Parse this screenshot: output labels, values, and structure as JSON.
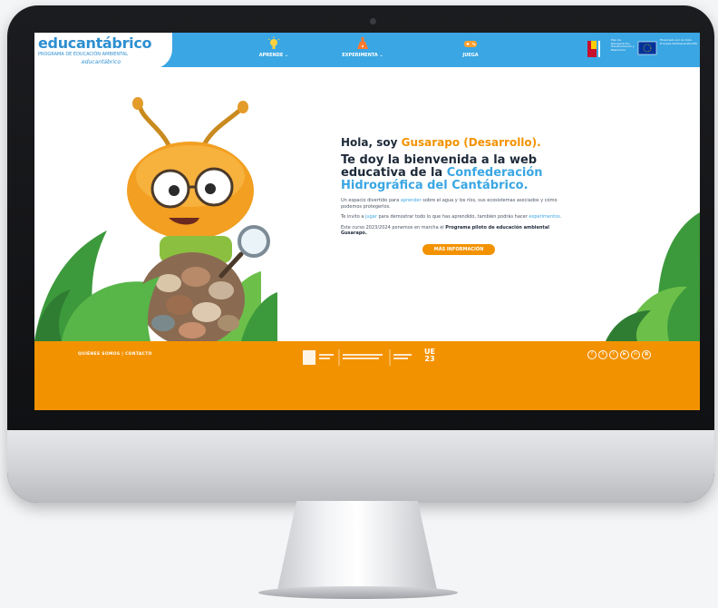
{
  "header": {
    "logo_title": "educantábrico",
    "logo_subtitle": "PROGRAMA DE EDUCACIÓN AMBIENTAL",
    "logo_subtitle2": "educantábrico",
    "nav": [
      {
        "label": "APRENDE ⌄",
        "icon": "lightbulb-icon"
      },
      {
        "label": "EXPERIMENTA ⌄",
        "icon": "flask-icon"
      },
      {
        "label": "JUEGA",
        "icon": "gamepad-icon"
      }
    ],
    "eu_text_1": "Plan de Recuperación, Transformación y Resiliencia",
    "eu_text_2": "Financiado por la Unión Europea NextGenerationEU"
  },
  "hero": {
    "greeting_prefix": "Hola, soy ",
    "greeting_name": "Gusarapo (Desarrollo).",
    "welcome_prefix": "Te doy la bienvenida a la web educativa de la ",
    "welcome_org": "Confederación Hidrográfica del Cantábrico.",
    "p1_a": "Un espacio divertido para ",
    "p1_link": "aprender",
    "p1_b": " sobre el agua y los ríos, sus ecosistemas asociados y cómo podemos protegerlos.",
    "p2_a": "Te invito a ",
    "p2_link1": "jugar",
    "p2_b": " para demostrar todo lo que has aprendido, también podrás hacer ",
    "p2_link2": "experimentos.",
    "p3_a": "Este curso 2023/2024 ponemos en marcha el ",
    "p3_bold": "Programa piloto de educación ambiental Gusarapo.",
    "more_button": "MÁS INFORMACIÓN"
  },
  "footer": {
    "links": "QUIÉNES SOMOS  |  CONTACTO",
    "ue_line1": "UE",
    "ue_line2": "23",
    "social": [
      {
        "icon": "facebook-icon",
        "glyph": "f"
      },
      {
        "icon": "x-twitter-icon",
        "glyph": "X"
      },
      {
        "icon": "twitter-icon",
        "glyph": "t"
      },
      {
        "icon": "youtube-icon",
        "glyph": "▶"
      },
      {
        "icon": "linkedin-icon",
        "glyph": "in"
      },
      {
        "icon": "flickr-icon",
        "glyph": "▦"
      }
    ]
  },
  "colors": {
    "nav_blue": "#3aa6e3",
    "accent_orange": "#f39200",
    "text_dark": "#1e2a3a"
  }
}
